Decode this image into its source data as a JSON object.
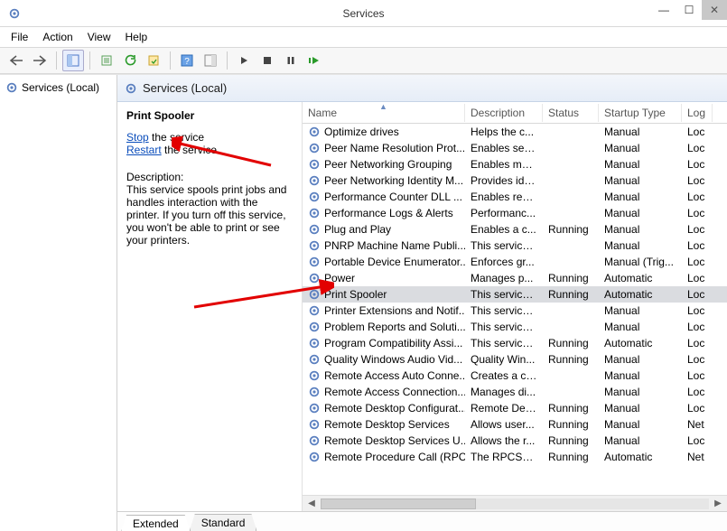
{
  "titlebar": {
    "title": "Services"
  },
  "menubar": {
    "file": "File",
    "action": "Action",
    "view": "View",
    "help": "Help"
  },
  "tree": {
    "root": "Services (Local)"
  },
  "header": {
    "title": "Services (Local)"
  },
  "detail": {
    "title": "Print Spooler",
    "stopLink": "Stop",
    "stopSuffix": " the service",
    "restartLink": "Restart",
    "restartSuffix": " the service",
    "descLabel": "Description:",
    "descText": "This service spools print jobs and handles interaction with the printer. If you turn off this service, you won't be able to print or see your printers."
  },
  "columns": {
    "name": "Name",
    "description": "Description",
    "status": "Status",
    "startup": "Startup Type",
    "logon": "Log"
  },
  "rows": [
    {
      "name": "Optimize drives",
      "desc": "Helps the c...",
      "status": "",
      "startup": "Manual",
      "logon": "Loc"
    },
    {
      "name": "Peer Name Resolution Prot...",
      "desc": "Enables serv...",
      "status": "",
      "startup": "Manual",
      "logon": "Loc"
    },
    {
      "name": "Peer Networking Grouping",
      "desc": "Enables mul...",
      "status": "",
      "startup": "Manual",
      "logon": "Loc"
    },
    {
      "name": "Peer Networking Identity M...",
      "desc": "Provides ide...",
      "status": "",
      "startup": "Manual",
      "logon": "Loc"
    },
    {
      "name": "Performance Counter DLL ...",
      "desc": "Enables rem...",
      "status": "",
      "startup": "Manual",
      "logon": "Loc"
    },
    {
      "name": "Performance Logs & Alerts",
      "desc": "Performanc...",
      "status": "",
      "startup": "Manual",
      "logon": "Loc"
    },
    {
      "name": "Plug and Play",
      "desc": "Enables a c...",
      "status": "Running",
      "startup": "Manual",
      "logon": "Loc"
    },
    {
      "name": "PNRP Machine Name Publi...",
      "desc": "This service ...",
      "status": "",
      "startup": "Manual",
      "logon": "Loc"
    },
    {
      "name": "Portable Device Enumerator...",
      "desc": "Enforces gr...",
      "status": "",
      "startup": "Manual (Trig...",
      "logon": "Loc"
    },
    {
      "name": "Power",
      "desc": "Manages p...",
      "status": "Running",
      "startup": "Automatic",
      "logon": "Loc"
    },
    {
      "name": "Print Spooler",
      "desc": "This service ...",
      "status": "Running",
      "startup": "Automatic",
      "logon": "Loc",
      "selected": true
    },
    {
      "name": "Printer Extensions and Notif...",
      "desc": "This service ...",
      "status": "",
      "startup": "Manual",
      "logon": "Loc"
    },
    {
      "name": "Problem Reports and Soluti...",
      "desc": "This service ...",
      "status": "",
      "startup": "Manual",
      "logon": "Loc"
    },
    {
      "name": "Program Compatibility Assi...",
      "desc": "This service ...",
      "status": "Running",
      "startup": "Automatic",
      "logon": "Loc"
    },
    {
      "name": "Quality Windows Audio Vid...",
      "desc": "Quality Win...",
      "status": "Running",
      "startup": "Manual",
      "logon": "Loc"
    },
    {
      "name": "Remote Access Auto Conne...",
      "desc": "Creates a co...",
      "status": "",
      "startup": "Manual",
      "logon": "Loc"
    },
    {
      "name": "Remote Access Connection...",
      "desc": "Manages di...",
      "status": "",
      "startup": "Manual",
      "logon": "Loc"
    },
    {
      "name": "Remote Desktop Configurat...",
      "desc": "Remote Des...",
      "status": "Running",
      "startup": "Manual",
      "logon": "Loc"
    },
    {
      "name": "Remote Desktop Services",
      "desc": "Allows user...",
      "status": "Running",
      "startup": "Manual",
      "logon": "Net"
    },
    {
      "name": "Remote Desktop Services U...",
      "desc": "Allows the r...",
      "status": "Running",
      "startup": "Manual",
      "logon": "Loc"
    },
    {
      "name": "Remote Procedure Call (RPC)",
      "desc": "The RPCSS ...",
      "status": "Running",
      "startup": "Automatic",
      "logon": "Net"
    }
  ],
  "tabs": {
    "extended": "Extended",
    "standard": "Standard"
  }
}
